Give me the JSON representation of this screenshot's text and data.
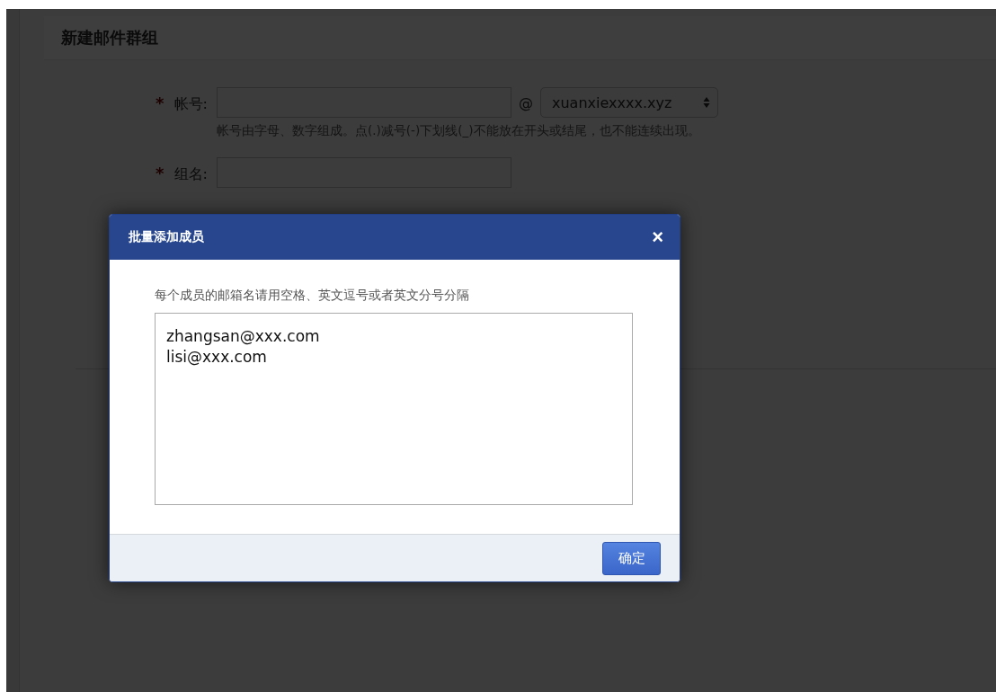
{
  "page": {
    "title": "新建邮件群组",
    "fields": [
      {
        "label": "帐号:",
        "required": true,
        "required_mark": "*",
        "domain": "xuanxiexxxx.xyz",
        "at": "@",
        "hint": "帐号由字母、数字组成。点(.)减号(-)下划线(_)不能放在开头或结尾，也不能连续出现。"
      },
      {
        "label": "组名:",
        "required": true,
        "required_mark": "*"
      }
    ]
  },
  "dialog": {
    "title": "批量添加成员",
    "close": "×",
    "hint": "每个成员的邮箱名请用空格、英文逗号或者英文分号分隔",
    "members": "zhangsan@xxx.com\nlisi@xxx.com",
    "buttons": [
      "确定"
    ]
  }
}
